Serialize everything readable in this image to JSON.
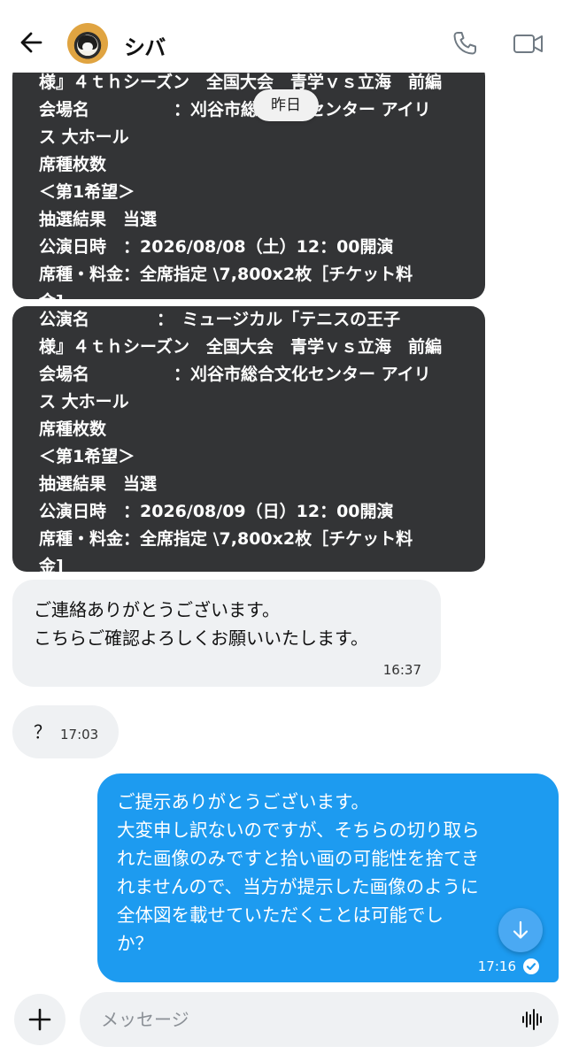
{
  "header": {
    "contact_name": "シバ"
  },
  "date_divider": "昨日",
  "messages": [
    {
      "id": "ticket-1",
      "lines": [
        "様』４ｔｈシーズン　全国大会　青学ｖｓ立海　前編",
        "会場名　　　　　：刈谷市総合文化センター アイリ",
        "ス 大ホール",
        "席種枚数",
        "＜第1希望＞",
        "抽選結果　当選",
        "公演日時　：2026/08/08（土）12：00開演",
        "席種・料金：全席指定 \\7,800x2枚［チケット料",
        "金]"
      ]
    },
    {
      "id": "ticket-2",
      "lines": [
        "公演名　　　　：　ミュージカル「テニスの王子",
        "様』４ｔｈシーズン　全国大会　青学ｖｓ立海　前編",
        "会場名　　　　　：刈谷市総合文化センター アイリ",
        "ス 大ホール",
        "席種枚数",
        "＜第1希望＞",
        "抽選結果　当選",
        "公演日時　：2026/08/09（日）12：00開演",
        "席種・料金：全席指定 \\7,800x2枚［チケット料",
        "金]"
      ]
    },
    {
      "id": "reply-1",
      "lines": [
        "ご連絡ありがとうございます。",
        "こちらご確認よろしくお願いいたします。"
      ],
      "time": "16:37"
    },
    {
      "id": "reply-2",
      "text": "？",
      "time": "17:03"
    },
    {
      "id": "outgoing-1",
      "lines": [
        "ご提示ありがとうございます。",
        "大変申し訳ないのですが、そちらの切り取ら",
        "れた画像のみですと拾い画の可能性を捨てき",
        "れませんので、当方が提示した画像のように",
        "全体図を載せていただくことは可能でし",
        "か？"
      ],
      "time": "17:16"
    }
  ],
  "composer": {
    "placeholder": "メッセージ"
  },
  "icons": {
    "back": "back-arrow-icon",
    "call": "phone-icon",
    "video": "video-camera-icon",
    "scroll": "arrow-down-icon",
    "add": "plus-icon",
    "voice": "voice-waveform-icon",
    "read": "check-icon"
  },
  "colors": {
    "dark_bubble": "#333436",
    "light_bubble": "#eff1f3",
    "outgoing_bubble": "#1d9bf0"
  }
}
